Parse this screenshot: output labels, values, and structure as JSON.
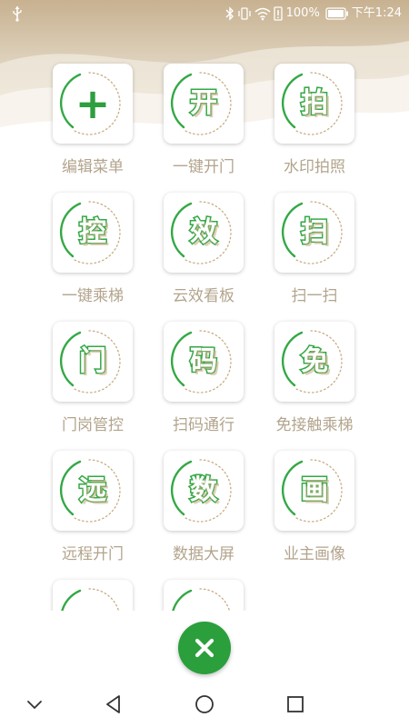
{
  "status_bar": {
    "battery_percent": "100%",
    "time": "下午1:24"
  },
  "grid": {
    "items": [
      {
        "label": "编辑菜单",
        "glyph": "+",
        "icon": "plus-icon"
      },
      {
        "label": "一键开门",
        "glyph": "开",
        "icon": "open-door-icon"
      },
      {
        "label": "水印拍照",
        "glyph": "拍",
        "icon": "photo-icon"
      },
      {
        "label": "一键乘梯",
        "glyph": "控",
        "icon": "elevator-icon"
      },
      {
        "label": "云效看板",
        "glyph": "效",
        "icon": "dashboard-icon"
      },
      {
        "label": "扫一扫",
        "glyph": "扫",
        "icon": "scan-icon"
      },
      {
        "label": "门岗管控",
        "glyph": "门",
        "icon": "gate-icon"
      },
      {
        "label": "扫码通行",
        "glyph": "码",
        "icon": "qr-pass-icon"
      },
      {
        "label": "免接触乘梯",
        "glyph": "免",
        "icon": "touchless-elevator-icon"
      },
      {
        "label": "远程开门",
        "glyph": "远",
        "icon": "remote-open-icon"
      },
      {
        "label": "数据大屏",
        "glyph": "数",
        "icon": "data-screen-icon"
      },
      {
        "label": "业主画像",
        "glyph": "画",
        "icon": "owner-profile-icon"
      }
    ]
  },
  "close_button": {
    "icon": "close-icon"
  },
  "nav_bar": {
    "icons": [
      "chevron-down-icon",
      "back-icon",
      "home-icon",
      "recents-icon"
    ]
  },
  "colors": {
    "accent": "#2a9f3c",
    "label": "#b3a48d",
    "header_bg": "#cbb79b"
  }
}
